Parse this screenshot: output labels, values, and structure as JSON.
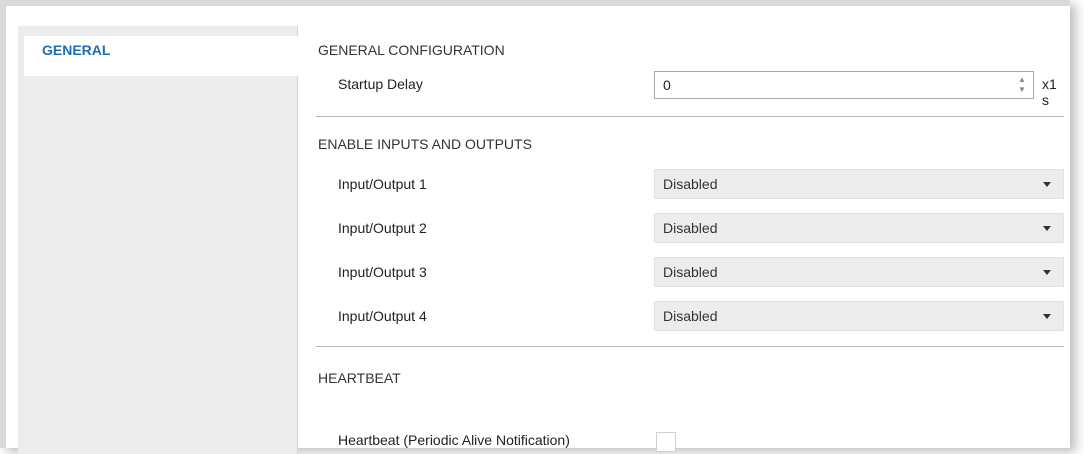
{
  "sidebar": {
    "items": [
      {
        "label": "GENERAL"
      }
    ]
  },
  "general_config": {
    "title": "GENERAL CONFIGURATION",
    "startup_delay": {
      "label": "Startup Delay",
      "value": "0",
      "unit": "x1 s"
    }
  },
  "io": {
    "title": "ENABLE INPUTS AND OUTPUTS",
    "rows": [
      {
        "label": "Input/Output 1",
        "value": "Disabled"
      },
      {
        "label": "Input/Output 2",
        "value": "Disabled"
      },
      {
        "label": "Input/Output 3",
        "value": "Disabled"
      },
      {
        "label": "Input/Output 4",
        "value": "Disabled"
      }
    ]
  },
  "heartbeat": {
    "title": "HEARTBEAT",
    "label": "Heartbeat (Periodic Alive Notification)",
    "checked": false
  },
  "colors": {
    "accent": "#1f6eb5",
    "sidebar_bg": "#ececec",
    "select_bg": "#ececec"
  }
}
